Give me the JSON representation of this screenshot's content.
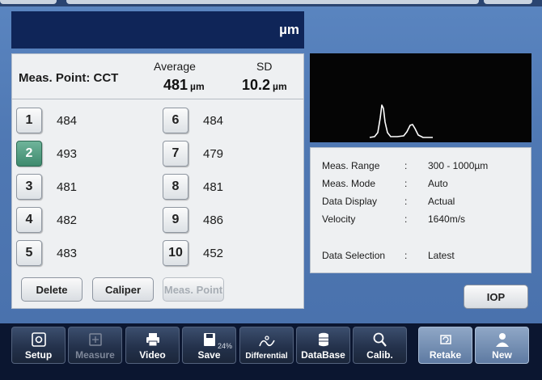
{
  "header": {
    "unit": "µm"
  },
  "measurement": {
    "point_label": "Meas. Point: CCT",
    "average_label": "Average",
    "average_value": "481",
    "average_unit": "µm",
    "sd_label": "SD",
    "sd_value": "10.2",
    "sd_unit": "µm",
    "points": [
      {
        "num": "1",
        "value": "484"
      },
      {
        "num": "2",
        "value": "493"
      },
      {
        "num": "3",
        "value": "481"
      },
      {
        "num": "4",
        "value": "482"
      },
      {
        "num": "5",
        "value": "483"
      },
      {
        "num": "6",
        "value": "484"
      },
      {
        "num": "7",
        "value": "479"
      },
      {
        "num": "8",
        "value": "481"
      },
      {
        "num": "9",
        "value": "486"
      },
      {
        "num": "10",
        "value": "452"
      }
    ],
    "selected_point": "2",
    "buttons": {
      "delete": "Delete",
      "caliper": "Caliper",
      "meas_point": "Meas. Point"
    }
  },
  "info": {
    "meas_range_label": "Meas. Range",
    "meas_range_value": "300 - 1000µm",
    "meas_mode_label": "Meas. Mode",
    "meas_mode_value": "Auto",
    "data_display_label": "Data Display",
    "data_display_value": "Actual",
    "velocity_label": "Velocity",
    "velocity_value": "1640m/s",
    "data_selection_label": "Data Selection",
    "data_selection_value": "Latest",
    "separator": ":"
  },
  "iop_button": "IOP",
  "toolbar": {
    "setup": "Setup",
    "measure": "Measure",
    "video": "Video",
    "save": "Save",
    "save_percent": "24%",
    "differential": "Differential",
    "database": "DataBase",
    "calib": "Calib.",
    "retake": "Retake",
    "new": "New"
  },
  "colors": {
    "selected_point": "#3e8a6e",
    "screen_bg": "#4f78b3",
    "unit_bar": "#0f2558",
    "waveform_trace": "#ffffff"
  }
}
